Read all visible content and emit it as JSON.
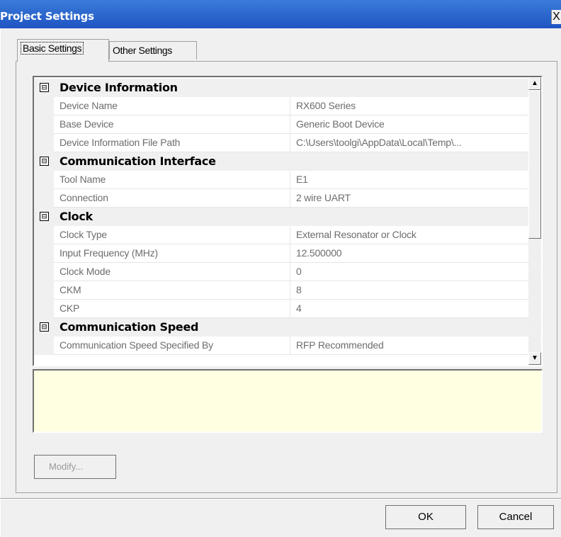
{
  "window": {
    "title": "Project Settings",
    "close_label": "X"
  },
  "tabs": [
    {
      "label": "Basic Settings",
      "active": true
    },
    {
      "label": "Other Settings",
      "active": false
    }
  ],
  "grid": {
    "rows": [
      {
        "kind": "category",
        "label": "Device Information",
        "expander": "⊟"
      },
      {
        "kind": "property",
        "name": "Device Name",
        "value": "RX600 Series"
      },
      {
        "kind": "property",
        "name": "Base Device",
        "value": "Generic Boot Device"
      },
      {
        "kind": "property",
        "name": "Device Information File Path",
        "value": "C:\\Users\\toolgi\\AppData\\Local\\Temp\\..."
      },
      {
        "kind": "category",
        "label": "Communication Interface",
        "expander": "⊟"
      },
      {
        "kind": "property",
        "name": "Tool Name",
        "value": "E1"
      },
      {
        "kind": "property",
        "name": "Connection",
        "value": "2 wire UART"
      },
      {
        "kind": "category",
        "label": "Clock",
        "expander": "⊟"
      },
      {
        "kind": "property",
        "name": "Clock Type",
        "value": "External Resonator or Clock"
      },
      {
        "kind": "property",
        "name": "Input Frequency (MHz)",
        "value": "12.500000"
      },
      {
        "kind": "property",
        "name": "Clock Mode",
        "value": "0"
      },
      {
        "kind": "property",
        "name": "CKM",
        "value": "8"
      },
      {
        "kind": "property",
        "name": "CKP",
        "value": "4"
      },
      {
        "kind": "category",
        "label": "Communication Speed",
        "expander": "⊟"
      },
      {
        "kind": "property",
        "name": "Communication Speed Specified By",
        "value": "RFP Recommended"
      }
    ]
  },
  "description": "",
  "buttons": {
    "modify": "Modify...",
    "ok": "OK",
    "cancel": "Cancel"
  },
  "colors": {
    "title_bar": "#1f55c4",
    "description_bg": "#ffffe1",
    "disabled_text": "#6d6d6d"
  },
  "icons": {
    "scroll_up": "▲",
    "scroll_down": "▼"
  }
}
